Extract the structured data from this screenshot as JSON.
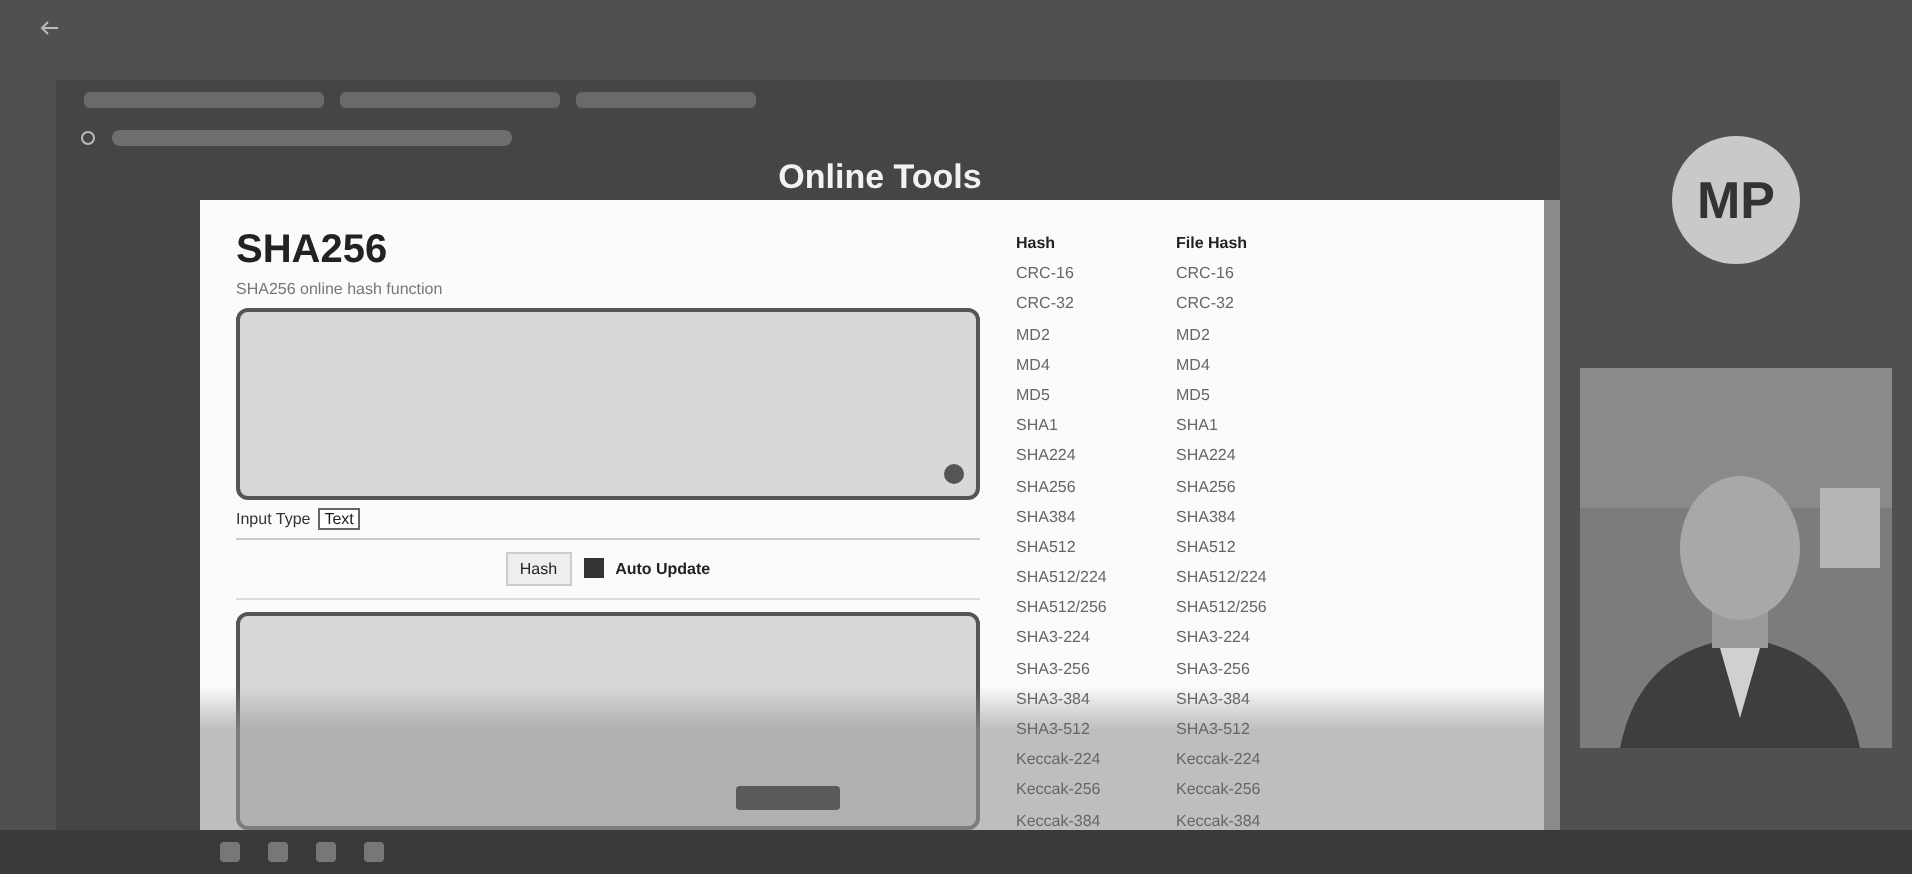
{
  "page": {
    "header_title": "Online Tools",
    "title": "SHA256",
    "subtitle": "SHA256 online hash function",
    "input_type": {
      "label": "Input Type",
      "value": "Text"
    },
    "hash_button": "Hash",
    "auto_update": {
      "label": "Auto Update",
      "checked": true
    },
    "columns": [
      "Hash",
      "File Hash"
    ],
    "rows": [
      {
        "hash": "CRC-16",
        "file_hash": "CRC-16"
      },
      {
        "hash": "CRC-32",
        "file_hash": "CRC-32"
      },
      {
        "hash": "MD2",
        "file_hash": "MD2"
      },
      {
        "hash": "MD4",
        "file_hash": "MD4"
      },
      {
        "hash": "MD5",
        "file_hash": "MD5"
      },
      {
        "hash": "SHA1",
        "file_hash": "SHA1"
      },
      {
        "hash": "SHA224",
        "file_hash": "SHA224"
      },
      {
        "hash": "SHA256",
        "file_hash": "SHA256"
      },
      {
        "hash": "SHA384",
        "file_hash": "SHA384"
      },
      {
        "hash": "SHA512",
        "file_hash": "SHA512"
      },
      {
        "hash": "SHA512/224",
        "file_hash": "SHA512/224"
      },
      {
        "hash": "SHA512/256",
        "file_hash": "SHA512/256"
      },
      {
        "hash": "SHA3-224",
        "file_hash": "SHA3-224"
      },
      {
        "hash": "SHA3-256",
        "file_hash": "SHA3-256"
      },
      {
        "hash": "SHA3-384",
        "file_hash": "SHA3-384"
      },
      {
        "hash": "SHA3-512",
        "file_hash": "SHA3-512"
      },
      {
        "hash": "Keccak-224",
        "file_hash": "Keccak-224"
      },
      {
        "hash": "Keccak-256",
        "file_hash": "Keccak-256"
      },
      {
        "hash": "Keccak-384",
        "file_hash": "Keccak-384"
      }
    ]
  },
  "call": {
    "avatar_initials": "MP"
  }
}
